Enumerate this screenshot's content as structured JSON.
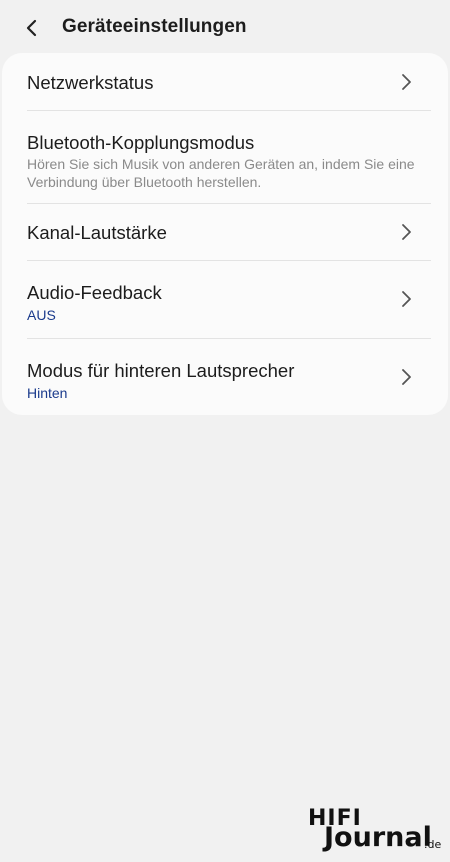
{
  "header": {
    "title": "Geräteeinstellungen",
    "back_icon": "chevron-left-icon"
  },
  "settings": {
    "items": [
      {
        "title": "Netzwerkstatus",
        "has_chevron": true
      },
      {
        "title": "Bluetooth-Kopplungsmodus",
        "description": "Hören Sie sich Musik von anderen Geräten an, indem Sie eine Verbindung über Bluetooth herstellen.",
        "has_chevron": false
      },
      {
        "title": "Kanal-Lautstärke",
        "has_chevron": true
      },
      {
        "title": "Audio-Feedback",
        "value": "AUS",
        "has_chevron": true
      },
      {
        "title": "Modus für hinteren Lautsprecher",
        "value": "Hinten",
        "has_chevron": true
      }
    ]
  },
  "watermark": {
    "brand_top": "HIFI",
    "brand_main": "Journal",
    "brand_suffix": ".de"
  },
  "colors": {
    "background": "#f1f1f1",
    "card": "#fbfbfb",
    "value_text": "#1a3a8c",
    "description_text": "#8a8a8a"
  }
}
